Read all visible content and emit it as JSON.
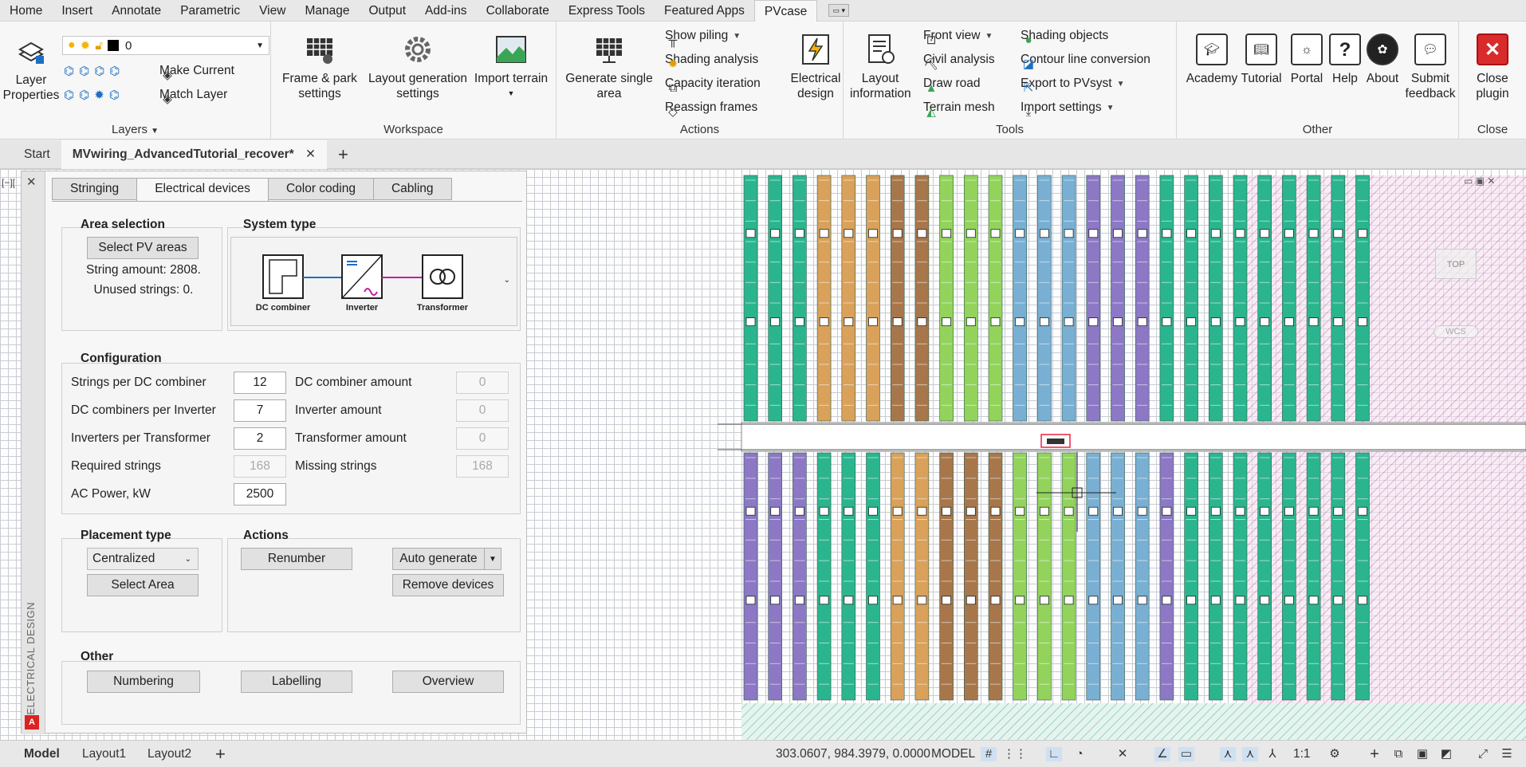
{
  "menu": {
    "tabs": [
      "Home",
      "Insert",
      "Annotate",
      "Parametric",
      "View",
      "Manage",
      "Output",
      "Add-ins",
      "Collaborate",
      "Express Tools",
      "Featured Apps",
      "PVcase"
    ],
    "active": "PVcase"
  },
  "ribbon": {
    "layers": {
      "title": "Layers",
      "layer_properties": "Layer\nProperties",
      "layer_value": "0",
      "make_current": "Make Current",
      "match_layer": "Match Layer"
    },
    "workspace": {
      "title": "Workspace",
      "frame_park": "Frame & park\nsettings",
      "layout_gen": "Layout generation\nsettings",
      "import_terrain": "Import terrain"
    },
    "actions": {
      "title": "Actions",
      "generate_single": "Generate single\narea",
      "show_piling": "Show piling",
      "shading_analysis": "Shading analysis",
      "capacity_iteration": "Capacity iteration",
      "reassign_frames": "Reassign frames",
      "electrical_design": "Electrical\ndesign"
    },
    "tools": {
      "title": "Tools",
      "layout_information": "Layout\ninformation",
      "front_view": "Front view",
      "civil_analysis": "Civil analysis",
      "draw_road": "Draw road",
      "terrain_mesh": "Terrain mesh",
      "shading_objects": "Shading objects",
      "contour_conversion": "Contour line conversion",
      "export_pvsyst": "Export to PVsyst",
      "import_settings": "Import settings"
    },
    "other": {
      "title": "Other",
      "academy": "Academy",
      "tutorial": "Tutorial",
      "portal": "Portal",
      "help": "Help",
      "about": "About",
      "submit_feedback": "Submit\nfeedback"
    },
    "close": {
      "title": "Close",
      "close_plugin": "Close\nplugin"
    }
  },
  "doc_tabs": {
    "start": "Start",
    "current": "MVwiring_AdvancedTutorial_recover*",
    "close": "✕",
    "add": "+"
  },
  "palette": {
    "side_label": "ELECTRICAL DESIGN",
    "tabs": [
      "Stringing",
      "Electrical devices",
      "Color coding",
      "Cabling"
    ],
    "active_tab": "Electrical devices",
    "area_selection": {
      "title": "Area selection",
      "select_button": "Select PV areas",
      "string_amount": "String amount: 2808.",
      "unused_strings": "Unused strings: 0."
    },
    "system_type": {
      "title": "System type",
      "dc_combiner": "DC combiner",
      "inverter": "Inverter",
      "transformer": "Transformer"
    },
    "configuration": {
      "title": "Configuration",
      "strings_per_dc_label": "Strings per DC combiner",
      "strings_per_dc": "12",
      "dc_per_inverter_label": "DC combiners per Inverter",
      "dc_per_inverter": "7",
      "inverters_per_transformer_label": "Inverters per Transformer",
      "inverters_per_transformer": "2",
      "required_strings_label": "Required strings",
      "required_strings": "168",
      "ac_power_label": "AC Power, kW",
      "ac_power": "2500",
      "dc_amount_label": "DC combiner amount",
      "dc_amount": "0",
      "inverter_amount_label": "Inverter amount",
      "inverter_amount": "0",
      "transformer_amount_label": "Transformer amount",
      "transformer_amount": "0",
      "missing_strings_label": "Missing strings",
      "missing_strings": "168"
    },
    "placement": {
      "title": "Placement type",
      "type": "Centralized",
      "select_area": "Select Area"
    },
    "actions": {
      "title": "Actions",
      "renumber": "Renumber",
      "auto_generate": "Auto generate",
      "remove_devices": "Remove devices"
    },
    "other": {
      "title": "Other",
      "numbering": "Numbering",
      "labelling": "Labelling",
      "overview": "Overview"
    }
  },
  "viewcube": {
    "top": "TOP",
    "wcs": "WCS"
  },
  "status": {
    "tabs": [
      "Model",
      "Layout1",
      "Layout2"
    ],
    "active": "Model",
    "coords": "303.0607, 984.3979, 0.0000",
    "mode": "MODEL",
    "scale": "1:1"
  },
  "colors": {
    "teal": "#2bb58f",
    "orange": "#d9a15a",
    "brown": "#a7774b",
    "lightgreen": "#93d35c",
    "blue": "#79afd2",
    "purple": "#8c78c4",
    "magenta_hatch": "#c04ea0",
    "accent": "#1e6fc2"
  }
}
